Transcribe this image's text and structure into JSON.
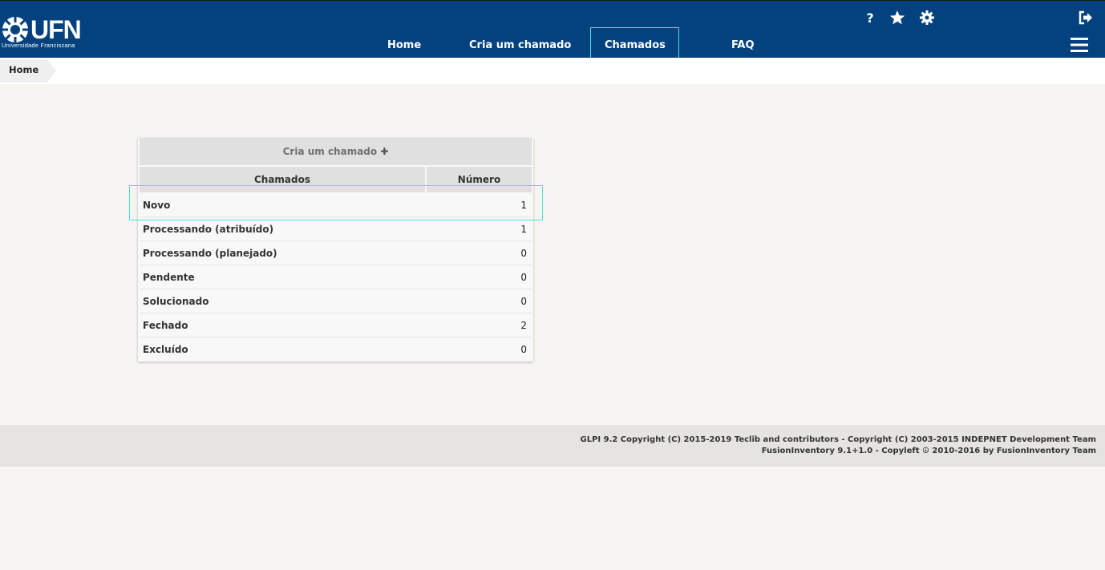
{
  "header": {
    "logo_text": "UFN",
    "logo_subtitle": "Universidade Franciscana",
    "nav": {
      "home": "Home",
      "create_ticket": "Cria um chamado",
      "tickets": "Chamados",
      "faq": "FAQ"
    },
    "icons": [
      "help-icon",
      "star-icon",
      "gear-icon",
      "logout-icon",
      "menu-icon"
    ],
    "background_color": "#03427f"
  },
  "breadcrumb": {
    "home": "Home"
  },
  "tickets_panel": {
    "create_link": "Cria um chamado",
    "columns": {
      "status": "Chamados",
      "count": "Número"
    },
    "rows": [
      {
        "label": "Novo",
        "value": "1"
      },
      {
        "label": "Processando (atribuído)",
        "value": "1"
      },
      {
        "label": "Processando (planejado)",
        "value": "0"
      },
      {
        "label": "Pendente",
        "value": "0"
      },
      {
        "label": "Solucionado",
        "value": "0"
      },
      {
        "label": "Fechado",
        "value": "2"
      },
      {
        "label": "Excluído",
        "value": "0"
      }
    ]
  },
  "footer": {
    "line1": "GLPI 9.2 Copyright (C) 2015-2019 Teclib and contributors - Copyright (C) 2003-2015 INDEPNET Development Team",
    "line2": "FusionInventory 9.1+1.0 - Copyleft ☮ 2010-2016 by FusionInventory Team"
  }
}
